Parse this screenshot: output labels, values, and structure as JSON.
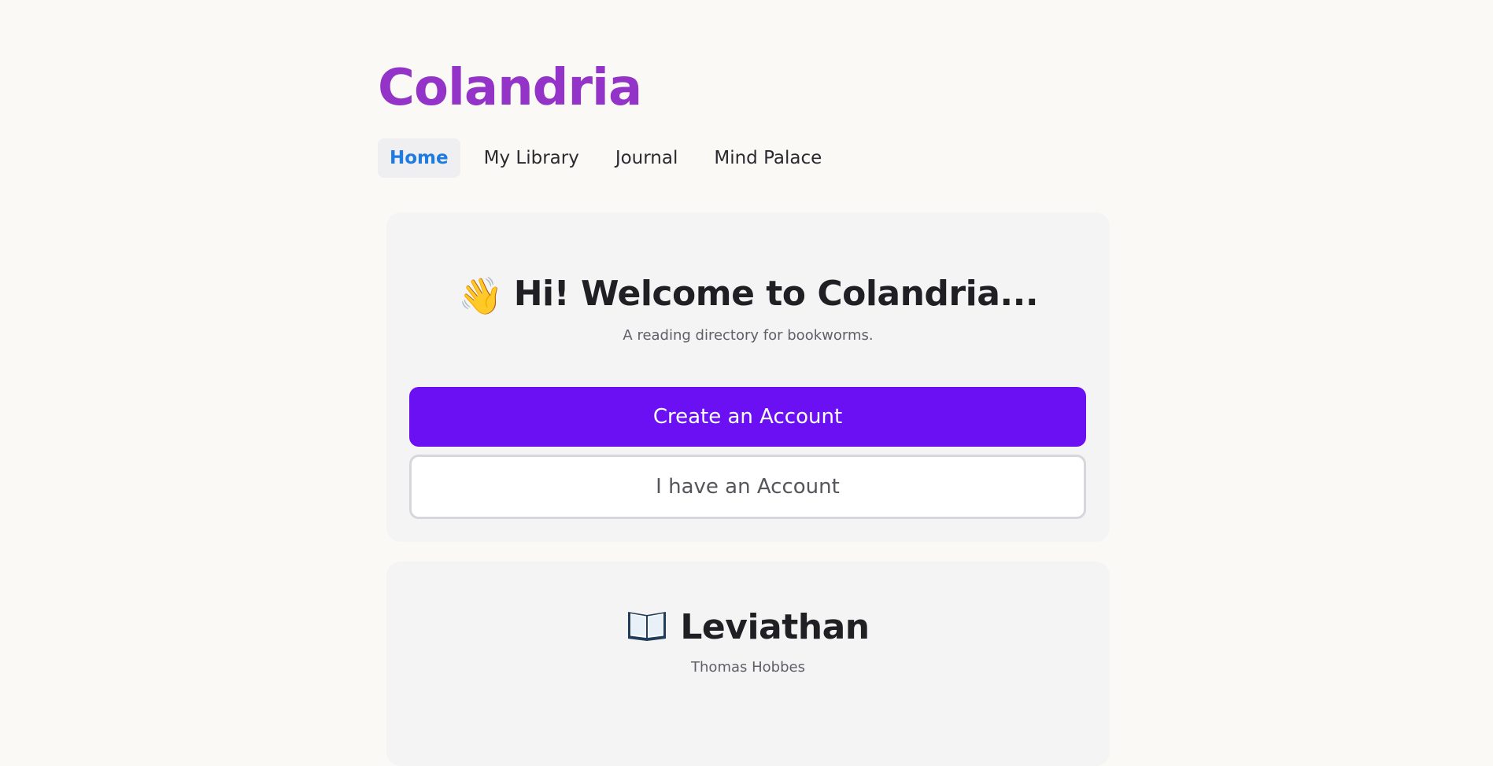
{
  "app": {
    "brand": "Colandria"
  },
  "nav": {
    "items": [
      {
        "label": "Home",
        "active": true
      },
      {
        "label": "My Library",
        "active": false
      },
      {
        "label": "Journal",
        "active": false
      },
      {
        "label": "Mind Palace",
        "active": false
      }
    ]
  },
  "welcome": {
    "icon": "waving-hand-icon",
    "title": "Hi! Welcome to Colandria...",
    "subtitle": "A reading directory for bookworms.",
    "primary_button": "Create an Account",
    "secondary_button": "I have an Account"
  },
  "book": {
    "icon": "open-book-icon",
    "title": "Leviathan",
    "author": "Thomas Hobbes"
  },
  "colors": {
    "brand": "#9333c7",
    "nav_active": "#1e7be0",
    "primary": "#6a10f2",
    "background": "#faf9f5",
    "card": "#f4f4f5"
  }
}
